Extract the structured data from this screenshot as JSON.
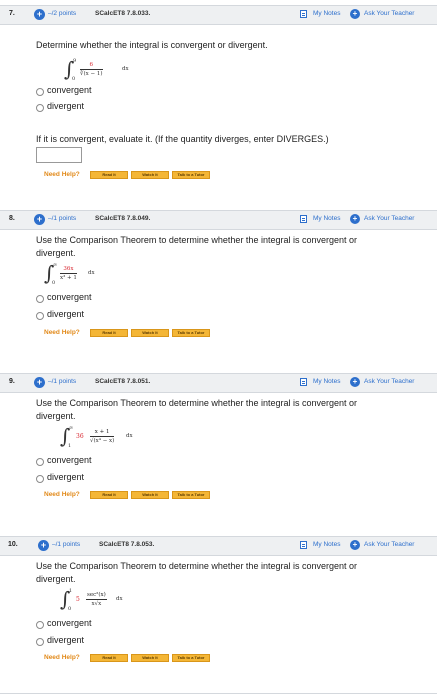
{
  "common": {
    "my_notes": "My Notes",
    "ask_teacher": "Ask Your Teacher",
    "need_help": "Need Help?",
    "read_it": "Read It",
    "watch_it": "Watch It",
    "talk_tutor": "Talk to a Tutor",
    "plus_glyph": "+",
    "opt_convergent": "convergent",
    "opt_divergent": "divergent"
  },
  "questions": [
    {
      "number": "7.",
      "points": "–/2 points",
      "id": "SCalcET8 7.8.033.",
      "prompt": "Determine whether the integral is convergent or divergent.",
      "integral": {
        "upper": "9",
        "lower": "0",
        "numerator": "6",
        "denominator": "∛(x − 1)",
        "dx": "dx"
      },
      "followup": "If it is convergent, evaluate it. (If the quantity diverges, enter DIVERGES.)",
      "answer_value": ""
    },
    {
      "number": "8.",
      "points": "–/1 points",
      "id": "SCalcET8 7.8.049.",
      "prompt_line1": "Use the Comparison Theorem to determine whether the integral is convergent or",
      "prompt_line2": "divergent.",
      "integral": {
        "upper": "∞",
        "lower": "0",
        "numerator": "36x",
        "denominator": "x³ + 1",
        "dx": "dx"
      }
    },
    {
      "number": "9.",
      "points": "–/1 points",
      "id": "SCalcET8 7.8.051.",
      "prompt_line1": "Use the Comparison Theorem to determine whether the integral is convergent or",
      "prompt_line2": "divergent.",
      "integral": {
        "upper": "∞",
        "lower": "1",
        "coefficient": "36",
        "numerator": "x + 1",
        "denominator": "√(x⁴ − x)",
        "dx": "dx"
      }
    },
    {
      "number": "10.",
      "points": "–/1 points",
      "id": "SCalcET8 7.8.053.",
      "prompt_line1": "Use the Comparison Theorem to determine whether the integral is convergent or",
      "prompt_line2": "divergent.",
      "integral": {
        "upper": "1",
        "lower": "0",
        "coefficient": "5",
        "numerator": "sec²(x)",
        "denominator": "x√x",
        "dx": "dx"
      }
    }
  ]
}
